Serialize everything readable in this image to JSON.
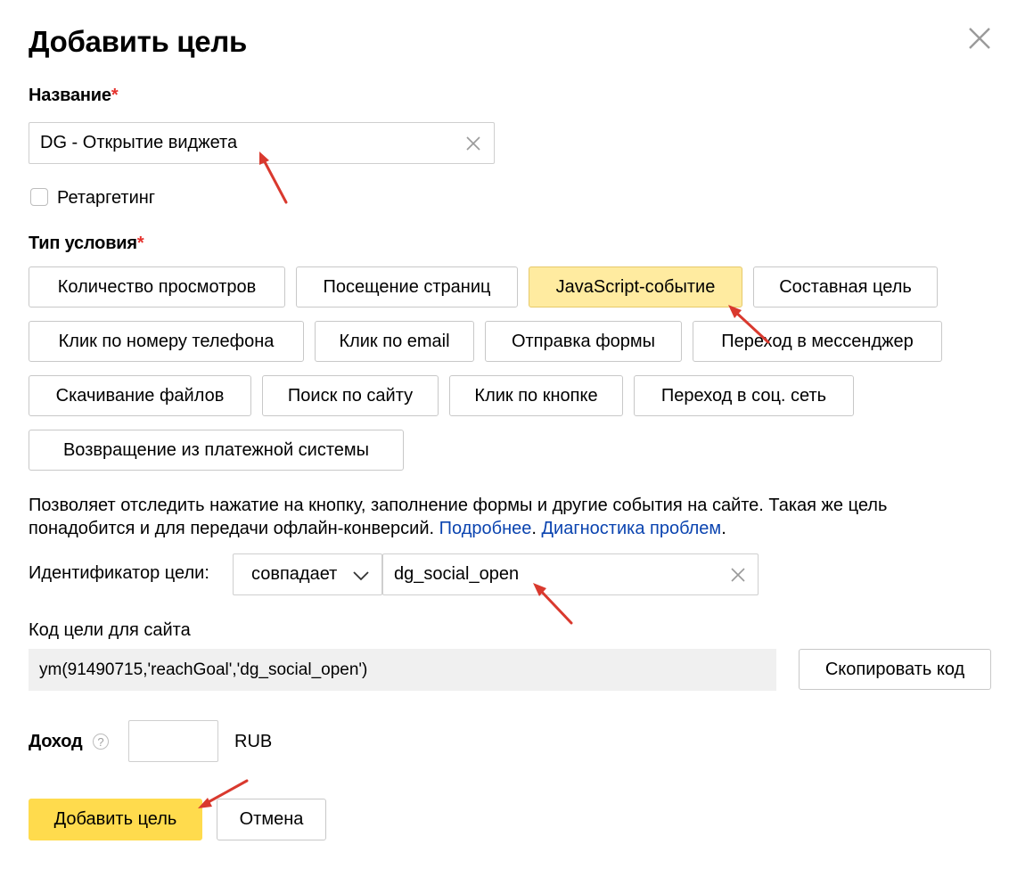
{
  "dialog": {
    "title": "Добавить цель",
    "close_icon": "close-icon"
  },
  "name_field": {
    "label": "Название",
    "required_mark": "*",
    "value": "DG - Открытие виджета"
  },
  "retargeting": {
    "label": "Ретаргетинг",
    "checked": false
  },
  "condition": {
    "label": "Тип условия",
    "required_mark": "*",
    "options": [
      "Количество просмотров",
      "Посещение страниц",
      "JavaScript-событие",
      "Составная цель",
      "Клик по номеру телефона",
      "Клик по email",
      "Отправка формы",
      "Переход в мессенджер",
      "Скачивание файлов",
      "Поиск по сайту",
      "Клик по кнопке",
      "Переход в соц. сеть",
      "Возвращение из платежной системы"
    ],
    "selected": "JavaScript-событие"
  },
  "description": {
    "text": "Позволяет отследить нажатие на кнопку, заполнение формы и другие события на сайте. Такая же цель понадобится и для передачи офлайн-конверсий.",
    "link_more": "Подробнее",
    "link_diag": "Диагностика проблем",
    "end": "."
  },
  "identifier": {
    "label": "Идентификатор цели:",
    "match_mode": "совпадает",
    "value": "dg_social_open"
  },
  "site_code": {
    "label": "Код цели для сайта",
    "code": "ym(91490715,'reachGoal','dg_social_open')",
    "copy_button": "Скопировать код"
  },
  "income": {
    "label": "Доход",
    "help_icon": "question-circle-icon",
    "value": "",
    "currency": "RUB"
  },
  "actions": {
    "submit": "Добавить цель",
    "cancel": "Отмена"
  },
  "colors": {
    "primary_button": "#ffdb4d",
    "selected_option": "#ffeba0",
    "link": "#0b44b0",
    "required": "#e5322d",
    "annotation_arrow": "#d9392e"
  }
}
